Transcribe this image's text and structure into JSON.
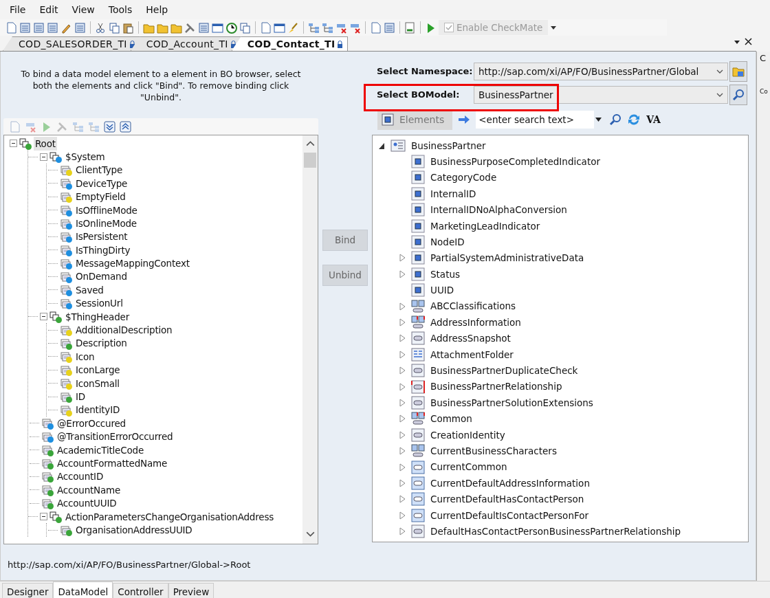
{
  "menu": [
    "File",
    "Edit",
    "View",
    "Tools",
    "Help"
  ],
  "checkmate": {
    "label": "Enable CheckMate",
    "checked": true,
    "disabled": true
  },
  "doc_tabs": [
    {
      "label": "COD_SALESORDER_TI",
      "selected": false
    },
    {
      "label": "COD_Account_TI",
      "selected": false
    },
    {
      "label": "COD_Contact_TI",
      "selected": true
    }
  ],
  "instructions": "To bind a data model element to a element in BO browser, select both the elements and click \"Bind\". To remove binding click \"Unbind\".",
  "data_model_tree": [
    {
      "label": "Root",
      "color": "#3aa53a",
      "selected": true,
      "expanded": true,
      "children": [
        {
          "label": "$System",
          "color": "#1e8fe0",
          "selected": false,
          "expanded": true,
          "children": [
            {
              "label": "ClientType",
              "color": "#e8d21a",
              "selected": false
            },
            {
              "label": "DeviceType",
              "color": "#1e8fe0",
              "selected": false
            },
            {
              "label": "EmptyField",
              "color": "#e8d21a",
              "selected": false
            },
            {
              "label": "IsOfflineMode",
              "color": "#1e8fe0",
              "selected": false
            },
            {
              "label": "IsOnlineMode",
              "color": "#1e8fe0",
              "selected": false
            },
            {
              "label": "IsPersistent",
              "color": "#1e8fe0",
              "selected": false
            },
            {
              "label": "IsThingDirty",
              "color": "#1e8fe0",
              "selected": false
            },
            {
              "label": "MessageMappingContext",
              "color": "#1e8fe0",
              "selected": false
            },
            {
              "label": "OnDemand",
              "color": "#1e8fe0",
              "selected": false
            },
            {
              "label": "Saved",
              "color": "#1e8fe0",
              "selected": false
            },
            {
              "label": "SessionUrl",
              "color": "#1e8fe0",
              "selected": false
            }
          ]
        },
        {
          "label": "$ThingHeader",
          "color": "#3aa53a",
          "selected": false,
          "expanded": true,
          "children": [
            {
              "label": "AdditionalDescription",
              "color": "#e8d21a",
              "selected": false
            },
            {
              "label": "Description",
              "color": "#3aa53a",
              "selected": false
            },
            {
              "label": "Icon",
              "color": "#e8d21a",
              "selected": false
            },
            {
              "label": "IconLarge",
              "color": "#e8d21a",
              "selected": false
            },
            {
              "label": "IconSmall",
              "color": "#e8d21a",
              "selected": false
            },
            {
              "label": "ID",
              "color": "#3aa53a",
              "selected": false
            },
            {
              "label": "IdentityID",
              "color": "#e8d21a",
              "selected": false
            }
          ]
        },
        {
          "label": "@ErrorOccured",
          "color": "#1e8fe0",
          "selected": false
        },
        {
          "label": "@TransitionErrorOccurred",
          "color": "#1e8fe0",
          "selected": false
        },
        {
          "label": "AcademicTitleCode",
          "color": "#3aa53a",
          "selected": false
        },
        {
          "label": "AccountFormattedName",
          "color": "#3aa53a",
          "selected": false
        },
        {
          "label": "AccountID",
          "color": "#3aa53a",
          "selected": false
        },
        {
          "label": "AccountName",
          "color": "#3aa53a",
          "selected": false
        },
        {
          "label": "AccountUUID",
          "color": "#3aa53a",
          "selected": false
        },
        {
          "label": "ActionParametersChangeOrganisationAddress",
          "color": "#3aa53a",
          "selected": false,
          "expanded": true,
          "children": [
            {
              "label": "OrganisationAddressUUID",
              "color": "#3aa53a",
              "selected": false
            }
          ]
        }
      ]
    }
  ],
  "bind_buttons": [
    {
      "label": "Bind",
      "disabled": true
    },
    {
      "label": "Unbind",
      "disabled": true
    }
  ],
  "namespace": {
    "label": "Select Namespace:",
    "value": "http://sap.com/xi/AP/FO/BusinessPartner/Global"
  },
  "bo_model": {
    "label": "Select BOModel:",
    "value": "BusinessPartner",
    "highlighted": true
  },
  "bo_toolbar": {
    "elements_label": "Elements",
    "search_placeholder": "<enter search text>",
    "va_label": "VA"
  },
  "bo_tree": {
    "label": "BusinessPartner",
    "expanded": true,
    "children": [
      {
        "label": "BusinessPurposeCompletedIndicator",
        "kind": "element",
        "expandable": false
      },
      {
        "label": "CategoryCode",
        "kind": "element",
        "expandable": false
      },
      {
        "label": "InternalID",
        "kind": "element",
        "expandable": false
      },
      {
        "label": "InternalIDNoAlphaConversion",
        "kind": "element",
        "expandable": false
      },
      {
        "label": "MarketingLeadIndicator",
        "kind": "element",
        "expandable": false
      },
      {
        "label": "NodeID",
        "kind": "element",
        "expandable": false
      },
      {
        "label": "PartialSystemAdministrativeData",
        "kind": "element",
        "expandable": true
      },
      {
        "label": "Status",
        "kind": "element",
        "expandable": true
      },
      {
        "label": "UUID",
        "kind": "element",
        "expandable": false
      },
      {
        "label": "ABCClassifications",
        "kind": "multi",
        "expandable": true
      },
      {
        "label": "AddressInformation",
        "kind": "multi-red",
        "expandable": true
      },
      {
        "label": "AddressSnapshot",
        "kind": "link",
        "expandable": true
      },
      {
        "label": "AttachmentFolder",
        "kind": "folder",
        "expandable": true
      },
      {
        "label": "BusinessPartnerDuplicateCheck",
        "kind": "link",
        "expandable": true
      },
      {
        "label": "BusinessPartnerRelationship",
        "kind": "link-red",
        "expandable": true
      },
      {
        "label": "BusinessPartnerSolutionExtensions",
        "kind": "link",
        "expandable": true
      },
      {
        "label": "Common",
        "kind": "multi-red",
        "expandable": true
      },
      {
        "label": "CreationIdentity",
        "kind": "link",
        "expandable": true
      },
      {
        "label": "CurrentBusinessCharacters",
        "kind": "multi",
        "expandable": true
      },
      {
        "label": "CurrentCommon",
        "kind": "single",
        "expandable": true
      },
      {
        "label": "CurrentDefaultAddressInformation",
        "kind": "single",
        "expandable": true
      },
      {
        "label": "CurrentDefaultHasContactPerson",
        "kind": "single",
        "expandable": true
      },
      {
        "label": "CurrentDefaultIsContactPersonFor",
        "kind": "single",
        "expandable": true
      },
      {
        "label": "DefaultHasContactPersonBusinessPartnerRelationship",
        "kind": "link",
        "expandable": true
      }
    ]
  },
  "path": "http://sap.com/xi/AP/FO/BusinessPartner/Global->Root",
  "bottom_tabs": [
    {
      "label": "Designer",
      "selected": false
    },
    {
      "label": "DataModel",
      "selected": true
    },
    {
      "label": "Controller",
      "selected": false
    },
    {
      "label": "Preview",
      "selected": false
    }
  ],
  "side_panel": {
    "title": "C",
    "label": "Co"
  }
}
